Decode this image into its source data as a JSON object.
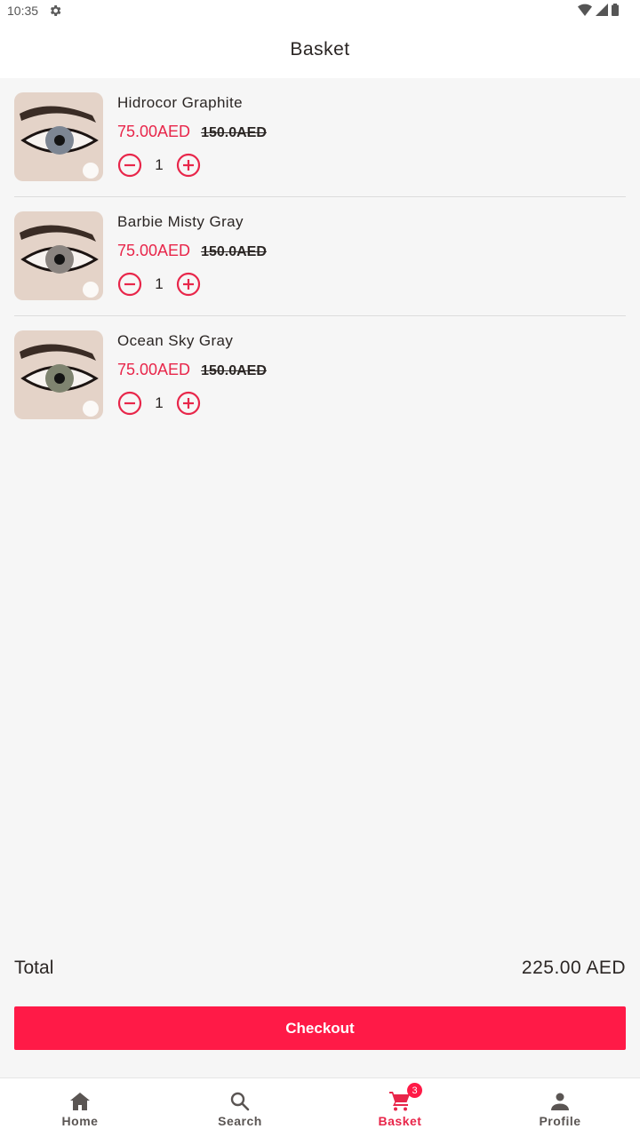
{
  "status_bar": {
    "time": "10:35"
  },
  "header": {
    "title": "Basket"
  },
  "items": [
    {
      "name": "Hidrocor Graphite",
      "price": "75.00AED",
      "old_price": "150.0AED",
      "quantity": "1",
      "iris_color": "#7d8693"
    },
    {
      "name": "Barbie Misty Gray",
      "price": "75.00AED",
      "old_price": "150.0AED",
      "quantity": "1",
      "iris_color": "#8a8480"
    },
    {
      "name": "Ocean Sky Gray",
      "price": "75.00AED",
      "old_price": "150.0AED",
      "quantity": "1",
      "iris_color": "#7f8470"
    }
  ],
  "summary": {
    "total_label": "Total",
    "total_value": "225.00 AED"
  },
  "checkout": {
    "label": "Checkout"
  },
  "nav": {
    "items": [
      {
        "label": "Home",
        "icon": "home-icon"
      },
      {
        "label": "Search",
        "icon": "search-icon"
      },
      {
        "label": "Basket",
        "icon": "cart-icon",
        "badge": "3",
        "active": true
      },
      {
        "label": "Profile",
        "icon": "person-icon"
      }
    ]
  },
  "colors": {
    "accent": "#ff1a47",
    "price": "#e8264a",
    "text": "#2b2624"
  }
}
